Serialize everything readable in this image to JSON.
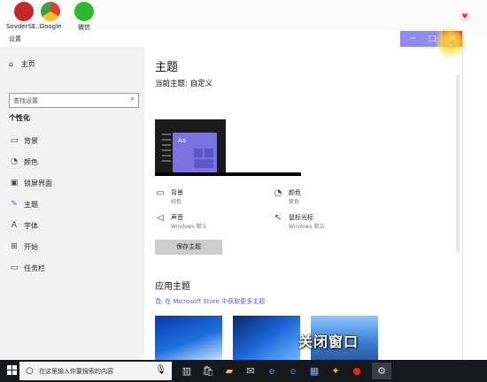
{
  "desktop": {
    "icons": [
      {
        "label": "SovderSE...",
        "icon": "app-red-icon",
        "color": "#c62828"
      },
      {
        "label": "Google",
        "icon": "chrome-icon",
        "color": "#e53935"
      },
      {
        "label": "微信",
        "icon": "wechat-icon",
        "color": "#2eb82e"
      }
    ]
  },
  "window": {
    "title": "设置",
    "controls": {
      "minimize": "─",
      "maximize": "□",
      "close": "✕"
    },
    "accent": "#8f8cf0",
    "close_color": "#e0271c"
  },
  "sidebar": {
    "home": "主页",
    "search_placeholder": "查找设置",
    "category": "个性化",
    "items": [
      {
        "label": "背景",
        "icon": "image-icon",
        "glyph": "▭"
      },
      {
        "label": "颜色",
        "icon": "palette-icon",
        "glyph": "◔"
      },
      {
        "label": "锁屏界面",
        "icon": "lockscreen-icon",
        "glyph": "▣"
      },
      {
        "label": "主题",
        "icon": "brush-icon",
        "glyph": "✎"
      },
      {
        "label": "字体",
        "icon": "font-icon",
        "glyph": "A"
      },
      {
        "label": "开始",
        "icon": "start-icon",
        "glyph": "⊞"
      },
      {
        "label": "任务栏",
        "icon": "taskbar-icon",
        "glyph": "▭"
      }
    ]
  },
  "main": {
    "title": "主题",
    "current_theme": "当前主题: 自定义",
    "preview_text": "Aa",
    "options": [
      {
        "label": "背景",
        "sub": "纯色",
        "icon": "image-icon",
        "glyph": "▭"
      },
      {
        "label": "颜色",
        "sub": "紫色",
        "icon": "palette-icon",
        "glyph": "◔"
      },
      {
        "label": "声音",
        "sub": "Windows 默认",
        "icon": "speaker-icon",
        "glyph": "◁"
      },
      {
        "label": "鼠标光标",
        "sub": "Windows 默认",
        "icon": "cursor-icon",
        "glyph": "↖"
      }
    ],
    "save_button": "保存主题",
    "apply_title": "应用主题",
    "store_link": "在 Microsoft Store 中获取更多主题",
    "caption": "关闭窗口"
  },
  "taskbar": {
    "search_text": "在这里输入你要搜索的内容",
    "icons": [
      {
        "icon": "task-view-icon",
        "glyph": "▥"
      },
      {
        "icon": "store-icon",
        "glyph": "🛍"
      },
      {
        "icon": "explorer-icon",
        "glyph": "▰"
      },
      {
        "icon": "mail-icon",
        "glyph": "✉"
      },
      {
        "icon": "edge-icon",
        "glyph": "e"
      },
      {
        "icon": "ie-icon",
        "glyph": "e"
      },
      {
        "icon": "photos-icon",
        "glyph": "▦"
      },
      {
        "icon": "bird-icon",
        "glyph": "✦"
      },
      {
        "icon": "record-icon",
        "glyph": "●"
      },
      {
        "icon": "settings-icon",
        "glyph": "⚙"
      }
    ]
  }
}
